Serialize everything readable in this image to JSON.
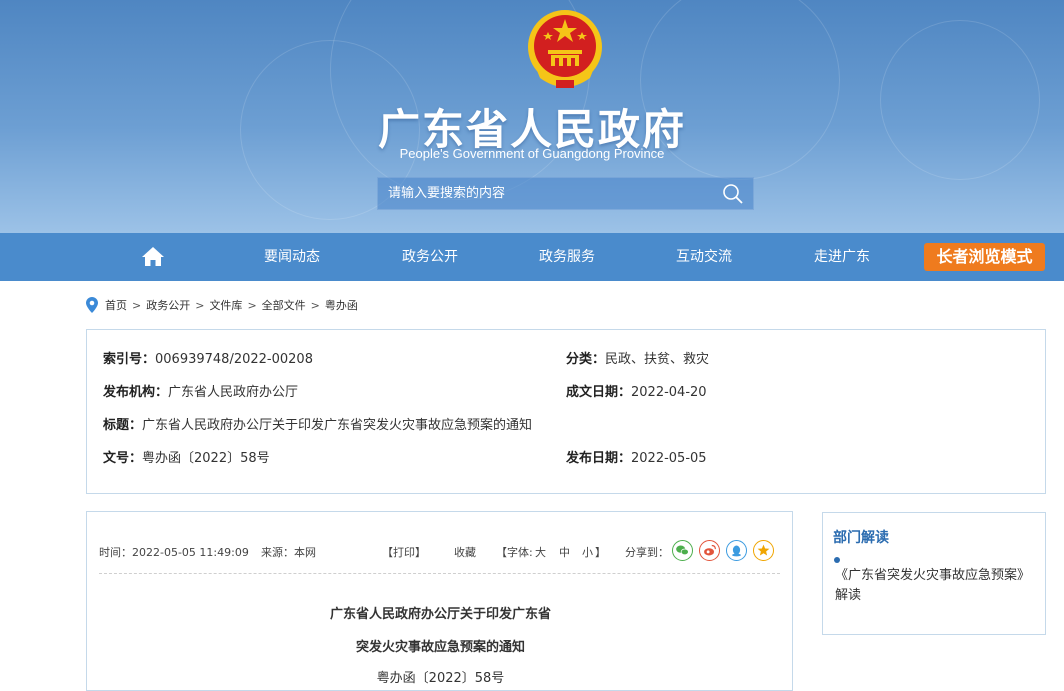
{
  "header": {
    "title": "广东省人民政府",
    "subtitle": "People's Government of Guangdong Province",
    "search_placeholder": "请输入要搜索的内容"
  },
  "nav": {
    "items": [
      "要闻动态",
      "政务公开",
      "政务服务",
      "互动交流",
      "走进广东"
    ],
    "elder_mode": "长者浏览模式"
  },
  "breadcrumb": [
    "首页",
    "政务公开",
    "文件库",
    "全部文件",
    "粤办函"
  ],
  "info": {
    "index_label": "索引号：",
    "index_value": "006939748/2022-00208",
    "category_label": "分类：",
    "category_value": "民政、扶贫、救灾",
    "issuer_label": "发布机构：",
    "issuer_value": "广东省人民政府办公厅",
    "created_label": "成文日期：",
    "created_value": "2022-04-20",
    "title_label": "标题：",
    "title_value": "广东省人民政府办公厅关于印发广东省突发火灾事故应急预案的通知",
    "docno_label": "文号：",
    "docno_value": "粤办函〔2022〕58号",
    "published_label": "发布日期：",
    "published_value": "2022-05-05"
  },
  "article": {
    "time": "时间：2022-05-05 11:49:09",
    "source": "来源：本网",
    "print": "【打印】",
    "favorite": "收藏",
    "font_label": "【字体:",
    "font_large": "大",
    "font_medium": "中",
    "font_small": "小",
    "font_close": "】",
    "share_label": "分享到：",
    "title_line1": "广东省人民政府办公厅关于印发广东省",
    "title_line2": "突发火灾事故应急预案的通知",
    "doc_no": "粤办函〔2022〕58号"
  },
  "side": {
    "title": "部门解读",
    "link": "《广东省突发火灾事故应急预案》解读"
  },
  "colors": {
    "nav_bg": "#4a8bcc",
    "elder_btn": "#ef7b1e",
    "wechat": "#4cae4c",
    "weibo": "#e2543b",
    "qq": "#3b9be0",
    "qzone": "#f0a500"
  }
}
